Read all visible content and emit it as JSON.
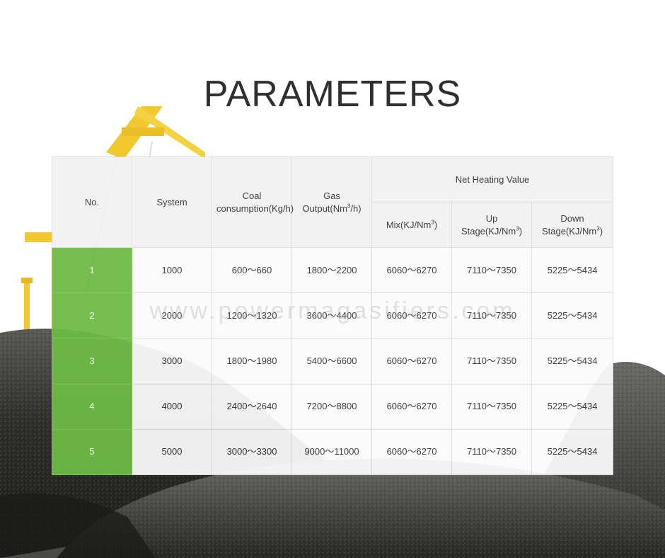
{
  "page": {
    "title": "PARAMETERS"
  },
  "watermark": "www.powermagasifiers.com",
  "table": {
    "headers": {
      "no": "No.",
      "system": "System",
      "coal": "Coal consumption(Kg/h)",
      "gas_prefix": "Gas Output(Nm",
      "gas_suffix": "/h)",
      "net": "Net Heating Value",
      "mix_prefix": "Mix(KJ/Nm",
      "up_prefix": "Up Stage(KJ/Nm",
      "down_prefix": "Down Stage(KJ/Nm",
      "sup": "3",
      "close": ")"
    },
    "rows": [
      {
        "no": "1",
        "system": "1000",
        "coal": "600～660",
        "gas": "1800～2200",
        "mix": "6060～6270",
        "up": "7110～7350",
        "down": "5225～5434"
      },
      {
        "no": "2",
        "system": "2000",
        "coal": "1200～1320",
        "gas": "3600～4400",
        "mix": "6060～6270",
        "up": "7110～7350",
        "down": "5225～5434"
      },
      {
        "no": "3",
        "system": "3000",
        "coal": "1800～1980",
        "gas": "5400～6600",
        "mix": "6060～6270",
        "up": "7110～7350",
        "down": "5225～5434"
      },
      {
        "no": "4",
        "system": "4000",
        "coal": "2400～2640",
        "gas": "7200～8800",
        "mix": "6060～6270",
        "up": "7110～7350",
        "down": "5225～5434"
      },
      {
        "no": "5",
        "system": "5000",
        "coal": "3000～3300",
        "gas": "9000～11000",
        "mix": "6060～6270",
        "up": "7110～7350",
        "down": "5225～5434"
      }
    ]
  },
  "colors": {
    "accent": "#6dbb45",
    "coal": "#2a2a2a",
    "crane": "#f0c419"
  }
}
